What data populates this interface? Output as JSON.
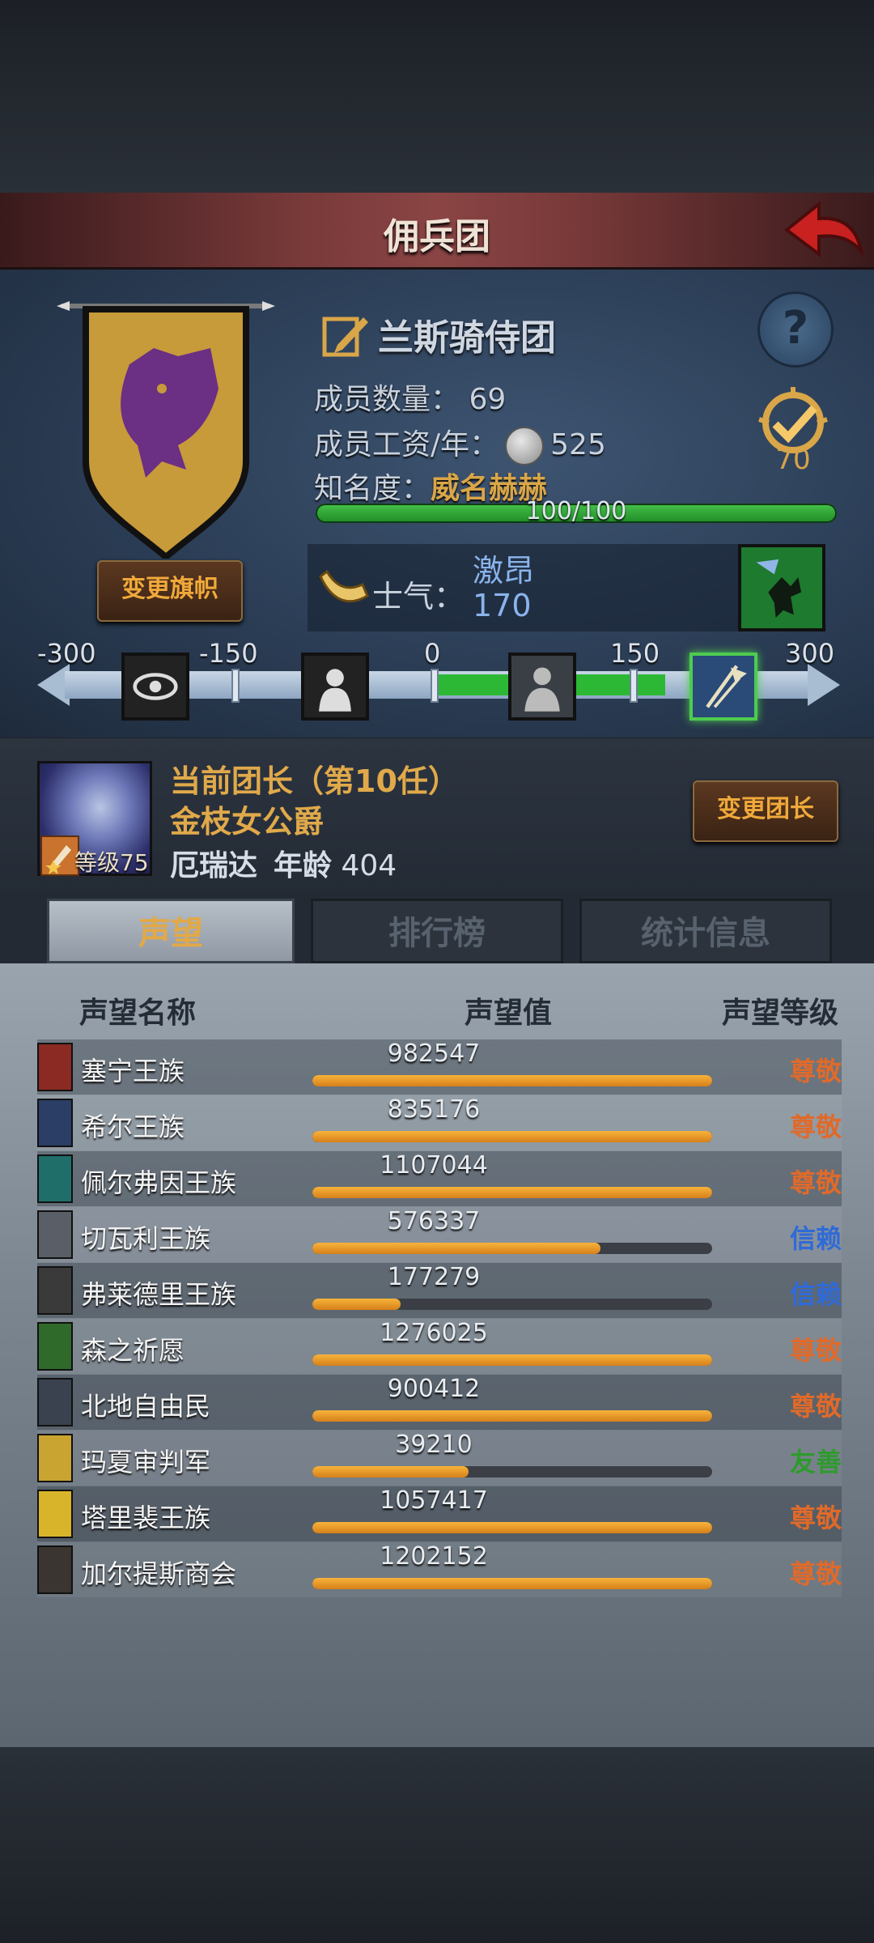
{
  "title": "佣兵团",
  "guild": {
    "name": "兰斯骑侍团",
    "member_count_label": "成员数量：",
    "member_count": "69",
    "salary_label": "成员工资/年：",
    "salary": "525",
    "fame_label": "知名度：",
    "fame_title": "威名赫赫",
    "fame_progress": "100/100",
    "fame_fraction": 1.0,
    "rank": "70",
    "change_flag_button": "变更旗帜"
  },
  "morale": {
    "label": "士气：",
    "state": "激昂",
    "value": "170",
    "scale": [
      "-300",
      "-150",
      "0",
      "150",
      "300"
    ]
  },
  "leader": {
    "line1": "当前团长（第10任）",
    "title": "金枝女公爵",
    "name": "厄瑞达",
    "age_label": "年龄",
    "age": "404",
    "level_label": "等级75",
    "change_button": "变更团长"
  },
  "tabs": [
    {
      "label": "声望",
      "active": true
    },
    {
      "label": "排行榜",
      "active": false
    },
    {
      "label": "统计信息",
      "active": false
    }
  ],
  "list_headers": {
    "name": "声望名称",
    "value": "声望值",
    "level": "声望等级"
  },
  "factions": [
    {
      "name": "塞宁王族",
      "value": "982547",
      "fill": 1.0,
      "level": "尊敬",
      "level_color": "#e06a2a",
      "icon_color": "#8a2a22"
    },
    {
      "name": "希尔王族",
      "value": "835176",
      "fill": 1.0,
      "level": "尊敬",
      "level_color": "#e06a2a",
      "icon_color": "#2a3e66"
    },
    {
      "name": "佩尔弗因王族",
      "value": "1107044",
      "fill": 1.0,
      "level": "尊敬",
      "level_color": "#e06a2a",
      "icon_color": "#1f6e6a"
    },
    {
      "name": "切瓦利王族",
      "value": "576337",
      "fill": 0.72,
      "level": "信赖",
      "level_color": "#2f6ad8",
      "icon_color": "#5a5e66"
    },
    {
      "name": "弗莱德里王族",
      "value": "177279",
      "fill": 0.22,
      "level": "信赖",
      "level_color": "#2f6ad8",
      "icon_color": "#3a3a3a"
    },
    {
      "name": "森之祈愿",
      "value": "1276025",
      "fill": 1.0,
      "level": "尊敬",
      "level_color": "#e06a2a",
      "icon_color": "#2f6a2a"
    },
    {
      "name": "北地自由民",
      "value": "900412",
      "fill": 1.0,
      "level": "尊敬",
      "level_color": "#e06a2a",
      "icon_color": "#3a4250"
    },
    {
      "name": "玛夏审判军",
      "value": "39210",
      "fill": 0.39,
      "level": "友善",
      "level_color": "#2e9a2e",
      "icon_color": "#c9a430"
    },
    {
      "name": "塔里裴王族",
      "value": "1057417",
      "fill": 1.0,
      "level": "尊敬",
      "level_color": "#e06a2a",
      "icon_color": "#d8b42a"
    },
    {
      "name": "加尔提斯商会",
      "value": "1202152",
      "fill": 1.0,
      "level": "尊敬",
      "level_color": "#e06a2a",
      "icon_color": "#3a3530"
    }
  ],
  "colors": {
    "accent_gold": "#e0a94a",
    "progress_green": "#2cb834",
    "rep_bar_orange": "#f2a230"
  }
}
